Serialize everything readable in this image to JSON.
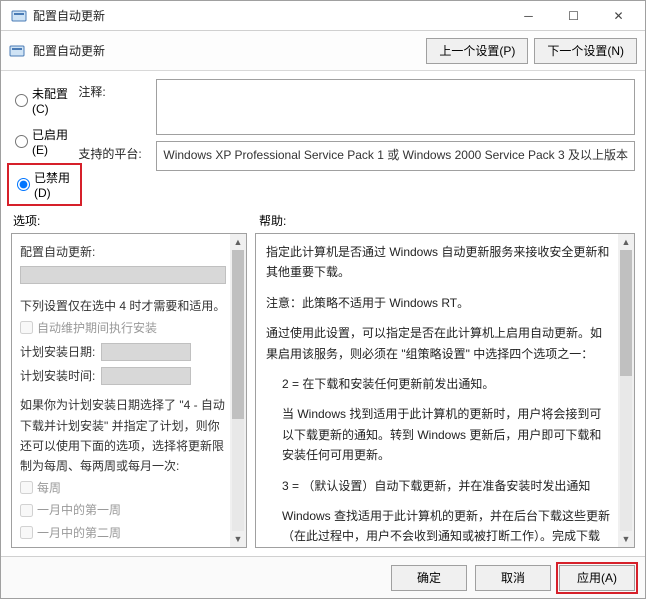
{
  "window": {
    "title": "配置自动更新",
    "sub_title": "配置自动更新"
  },
  "nav": {
    "prev": "上一个设置(P)",
    "next": "下一个设置(N)"
  },
  "radios": {
    "not_configured": "未配置(C)",
    "enabled": "已启用(E)",
    "disabled": "已禁用(D)"
  },
  "fields": {
    "comment_label": "注释:",
    "platform_label": "支持的平台:",
    "platform_text": "Windows XP Professional Service Pack 1 或 Windows 2000 Service Pack 3 及以上版本"
  },
  "pane_labels": {
    "options": "选项:",
    "help": "帮助:"
  },
  "options": {
    "heading": "配置自动更新:",
    "condition_line": "下列设置仅在选中 4 时才需要和适用。",
    "chk_maint_window": "自动维护期间执行安装",
    "install_date_label": "计划安装日期:",
    "install_time_label": "计划安装时间:",
    "note_text": "如果你为计划安装日期选择了 \"4 - 自动下载并计划安装\" 并指定了计划，则你还可以使用下面的选项，选择将更新限制为每周、每两周或每月一次:",
    "chk_every_week": "每周",
    "chk_first_week": "一月中的第一周",
    "chk_second_week": "一月中的第二周"
  },
  "help": {
    "p1": "指定此计算机是否通过 Windows 自动更新服务来接收安全更新和其他重要下载。",
    "p2": "注意：此策略不适用于 Windows RT。",
    "p3": "通过使用此设置，可以指定是否在此计算机上启用自动更新。如果启用该服务，则必须在 \"组策略设置\" 中选择四个选项之一：",
    "p4": "2 = 在下载和安装任何更新前发出通知。",
    "p5": "当 Windows 找到适用于此计算机的更新时，用户将会接到可以下载更新的通知。转到 Windows 更新后，用户即可下载和安装任何可用更新。",
    "p6": "3 = （默认设置）自动下载更新，并在准备安装时发出通知",
    "p7": "Windows 查找适用于此计算机的更新，并在后台下载这些更新（在此过程中，用户不会收到通知或被打断工作）。完成下载后，用户将收到可以安装更新的通知。转到 Windows 更新后，用户即可安装更新。"
  },
  "footer": {
    "ok": "确定",
    "cancel": "取消",
    "apply": "应用(A)"
  }
}
